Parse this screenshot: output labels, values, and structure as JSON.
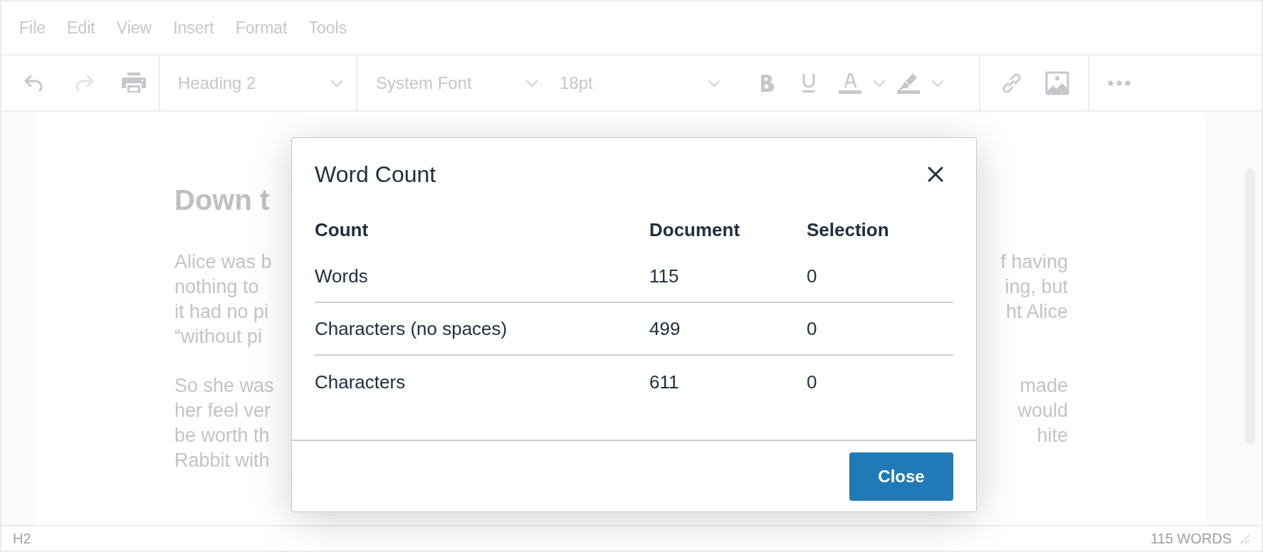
{
  "menubar": [
    "File",
    "Edit",
    "View",
    "Insert",
    "Format",
    "Tools"
  ],
  "toolbar": {
    "history": [
      {
        "kind": "undo",
        "disabled": false
      },
      {
        "kind": "redo",
        "disabled": true
      },
      {
        "kind": "print",
        "disabled": false
      }
    ],
    "block_format": "Heading 2",
    "font_family": "System Font",
    "font_size": "18pt",
    "format_buttons": [
      {
        "kind": "bold",
        "active": false
      },
      {
        "kind": "underline",
        "active": false
      },
      {
        "kind": "text-color",
        "active": false
      },
      {
        "kind": "highlight",
        "active": false
      }
    ],
    "insert_buttons": [
      {
        "kind": "link"
      },
      {
        "kind": "image"
      }
    ]
  },
  "document": {
    "heading": "Down t",
    "paragraphs": [
      {
        "left": [
          "Alice was b",
          "nothing to",
          "it had no pi",
          "“without pi"
        ],
        "right": [
          "f having",
          "ing, but",
          "ht Alice"
        ]
      },
      {
        "left": [
          "So she was",
          "her feel ver",
          "be worth th",
          "Rabbit with"
        ],
        "right": [
          "made",
          "would",
          "hite"
        ]
      }
    ]
  },
  "dialog": {
    "title": "Word Count",
    "columns": [
      "Count",
      "Document",
      "Selection"
    ],
    "rows": [
      [
        "Words",
        "115",
        "0"
      ],
      [
        "Characters (no spaces)",
        "499",
        "0"
      ],
      [
        "Characters",
        "611",
        "0"
      ]
    ],
    "button": "Close"
  },
  "status_bar": {
    "path": "H2",
    "word_count": "115 WORDS"
  }
}
